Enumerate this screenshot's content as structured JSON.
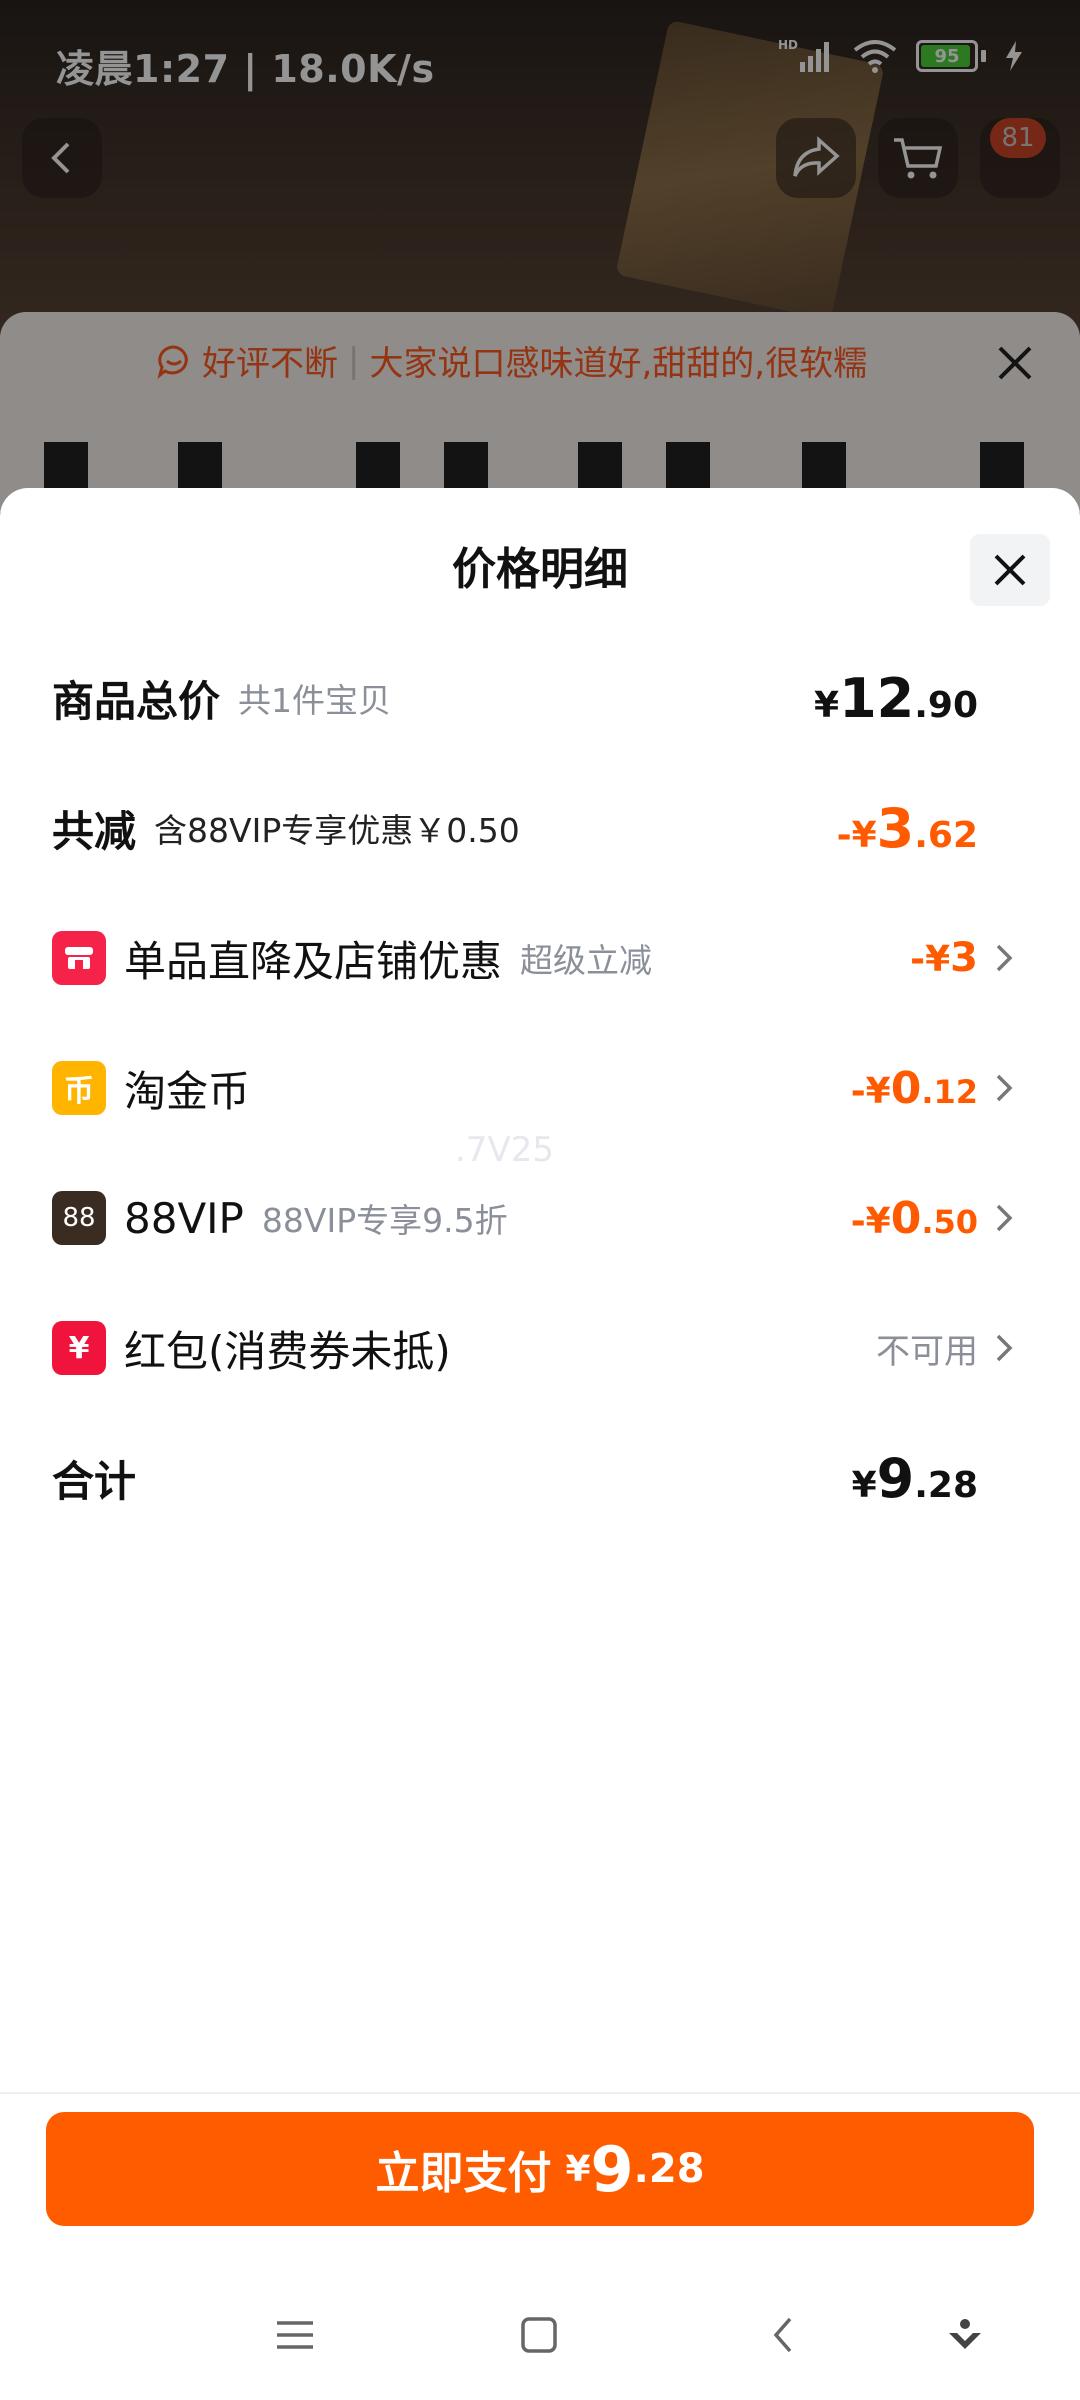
{
  "status_bar": {
    "time_speed": "凌晨1:27 | 18.0K/s",
    "network": "HD",
    "battery": "95",
    "battery_level": 0.95
  },
  "top_nav": {
    "cart_badge": "81"
  },
  "review_banner": {
    "tag": "好评不断",
    "text": "大家说口感味道好,甜甜的,很软糯"
  },
  "sheet": {
    "title": "价格明细",
    "watermark": ".7V25",
    "rows": [
      {
        "label": "商品总价",
        "sub": "共1件宝贝",
        "currency": "¥",
        "int": "12",
        "dec": ".90"
      },
      {
        "label": "共减",
        "sub": "含88VIP专享优惠￥0.50",
        "currency": "-¥",
        "int": "3",
        "dec": ".62"
      },
      {
        "label": "单品直降及店铺优惠",
        "sub": "超级立减",
        "currency": "-¥",
        "int": "3",
        "dec": ""
      },
      {
        "label": "淘金币",
        "sub": "",
        "currency": "-¥",
        "int": "0",
        "dec": ".12",
        "icon": "币"
      },
      {
        "label": "88VIP",
        "sub": "88VIP专享9.5折",
        "currency": "-¥",
        "int": "0",
        "dec": ".50",
        "icon": "88"
      },
      {
        "label": "红包(消费券未抵)",
        "sub": "",
        "value": "不可用",
        "icon": "¥"
      },
      {
        "label": "合计",
        "sub": "",
        "currency": "¥",
        "int": "9",
        "dec": ".28"
      }
    ]
  },
  "pay_button": {
    "label": "立即支付",
    "currency": "¥",
    "int": "9",
    "dec": ".28"
  },
  "colors": {
    "accent": "#ff5c00",
    "discount": "#ff5a00",
    "store_icon": "#f5224a",
    "coin_icon": "#ffb400",
    "vip_icon": "#3b2c22",
    "redpacket_icon": "#f0143c"
  },
  "icons": {
    "back": "back-arrow-icon",
    "share": "share-icon",
    "cart": "cart-icon",
    "close": "close-icon",
    "chevron": "chevron-right-icon"
  }
}
